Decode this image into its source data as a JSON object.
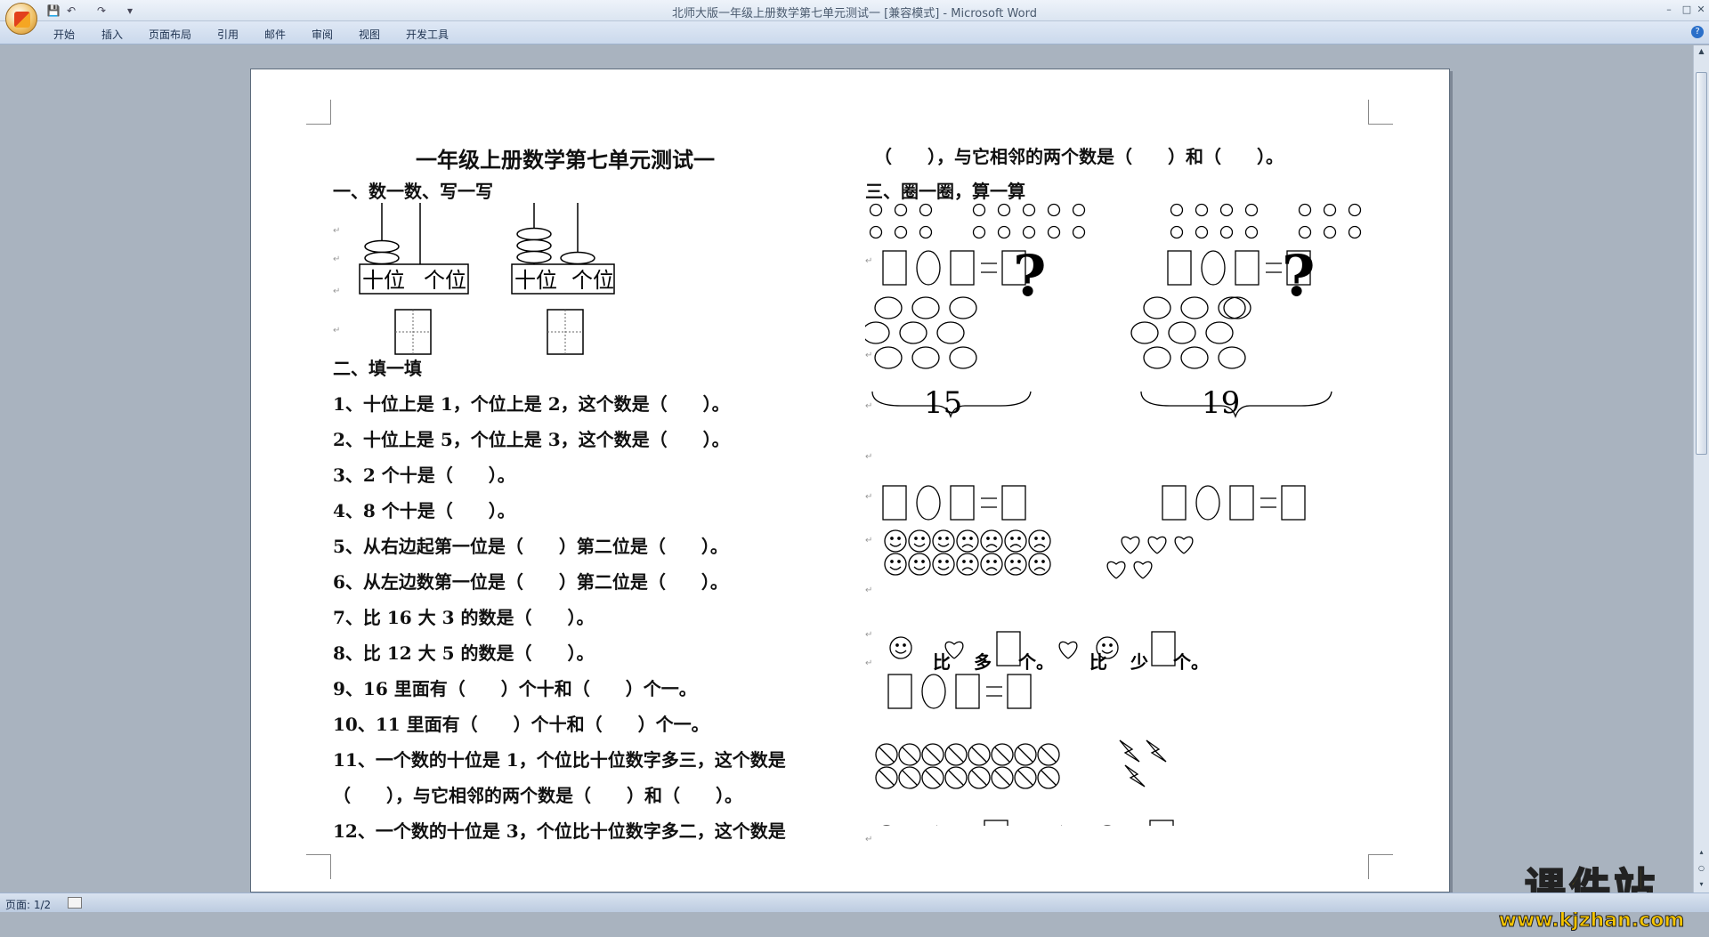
{
  "window": {
    "title": "北师大版一年级上册数学第七单元测试一 [兼容模式] - Microsoft Word",
    "ribbon_tabs": [
      "开始",
      "插入",
      "页面布局",
      "引用",
      "邮件",
      "审阅",
      "视图",
      "开发工具"
    ]
  },
  "status": {
    "page": "页面: 1/2"
  },
  "document": {
    "title": "一年级上册数学第七单元测试一",
    "sec1": "一、数一数、写一写",
    "place_ten": "十位",
    "place_one": "个位",
    "sec2": "二、填一填",
    "q": [
      "1、十位上是 1，个位上是 2，这个数是（　　）。",
      "2、十位上是 5，个位上是 3，这个数是（　　）。",
      "3、2 个十是（　　）。",
      "4、8 个十是（　　）。",
      "5、从右边起第一位是（　　）第二位是（　　）。",
      "6、从左边数第一位是（　　）第二位是（　　）。",
      "7、比 16 大 3 的数是（　　）。",
      "8、比 12 大 5 的数是（　　）。",
      "9、16 里面有（　　）个十和（　　）个一。",
      "10、11 里面有（　　）个十和（　　）个一。",
      "11、一个数的十位是 1，个位比十位数字多三，这个数是",
      "（　　），与它相邻的两个数是（　　）和（　　）。",
      "12、一个数的十位是 3，个位比十位数字多二，这个数是"
    ],
    "right_cont": "（　　），与它相邻的两个数是（　　）和（　　）。",
    "sec3": "三、圈一圈，算一算",
    "question_mark": "?",
    "total_a": "15",
    "total_b": "19",
    "bi": "比",
    "duo": "多",
    "shao": "少",
    "ge": "个。",
    "eq": "="
  },
  "watermark": {
    "main": "课件站",
    "url": "www.kjzhan.com"
  },
  "icons": [
    "office-button-icon",
    "save-icon",
    "undo-icon",
    "redo-icon",
    "help-icon",
    "smiley-icon",
    "frowny-icon",
    "heart-icon",
    "no-sign-icon",
    "lightning-icon"
  ]
}
